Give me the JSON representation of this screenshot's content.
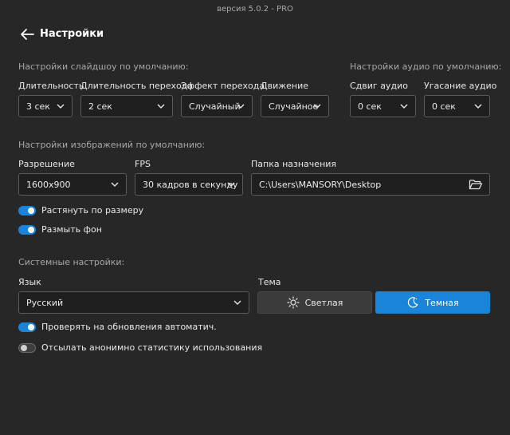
{
  "app": {
    "version": "версия 5.0.2 - PRO",
    "page_title": "Настройки"
  },
  "slideshow": {
    "section_title": "Настройки слайдшоу по умолчанию:",
    "duration": {
      "label": "Длительность",
      "value": "3 сек"
    },
    "transition_duration": {
      "label": "Длительность перехода",
      "value": "2 сек"
    },
    "transition_effect": {
      "label": "Эффект перехода",
      "value": "Случайный"
    },
    "motion": {
      "label": "Движение",
      "value": "Случайное"
    }
  },
  "audio": {
    "section_title": "Настройки аудио по умолчанию:",
    "shift": {
      "label": "Сдвиг аудио",
      "value": "0 сек"
    },
    "fade": {
      "label": "Угасание аудио",
      "value": "0 сек"
    }
  },
  "image": {
    "section_title": "Настройки изображений по умолчанию:",
    "resolution": {
      "label": "Разрешение",
      "value": "1600x900"
    },
    "fps": {
      "label": "FPS",
      "value": "30 кадров в секунду"
    },
    "destination": {
      "label": "Папка назначения",
      "value": "C:\\Users\\MANSORY\\Desktop"
    },
    "stretch": {
      "label": "Растянуть по размеру",
      "on": true
    },
    "blur": {
      "label": "Размыть фон",
      "on": true
    }
  },
  "system": {
    "section_title": "Системные настройки:",
    "language": {
      "label": "Язык",
      "value": "Русский"
    },
    "theme": {
      "label": "Тема",
      "light": "Светлая",
      "dark": "Темная",
      "selected": "dark"
    },
    "auto_update": {
      "label": "Проверять на обновления автоматич.",
      "on": true
    },
    "stats": {
      "label": "Отсылать анонимно статистику использования",
      "on": false
    }
  },
  "colors": {
    "background": "#272727",
    "accent": "#1a84d8",
    "field_bg": "#1f1f1f",
    "field_border": "#5b5b5b"
  },
  "icons": {
    "back": "arrow-left-icon",
    "chevron": "chevron-down-icon",
    "folder": "folder-open-icon",
    "sun": "sun-icon",
    "moon": "moon-icon"
  }
}
